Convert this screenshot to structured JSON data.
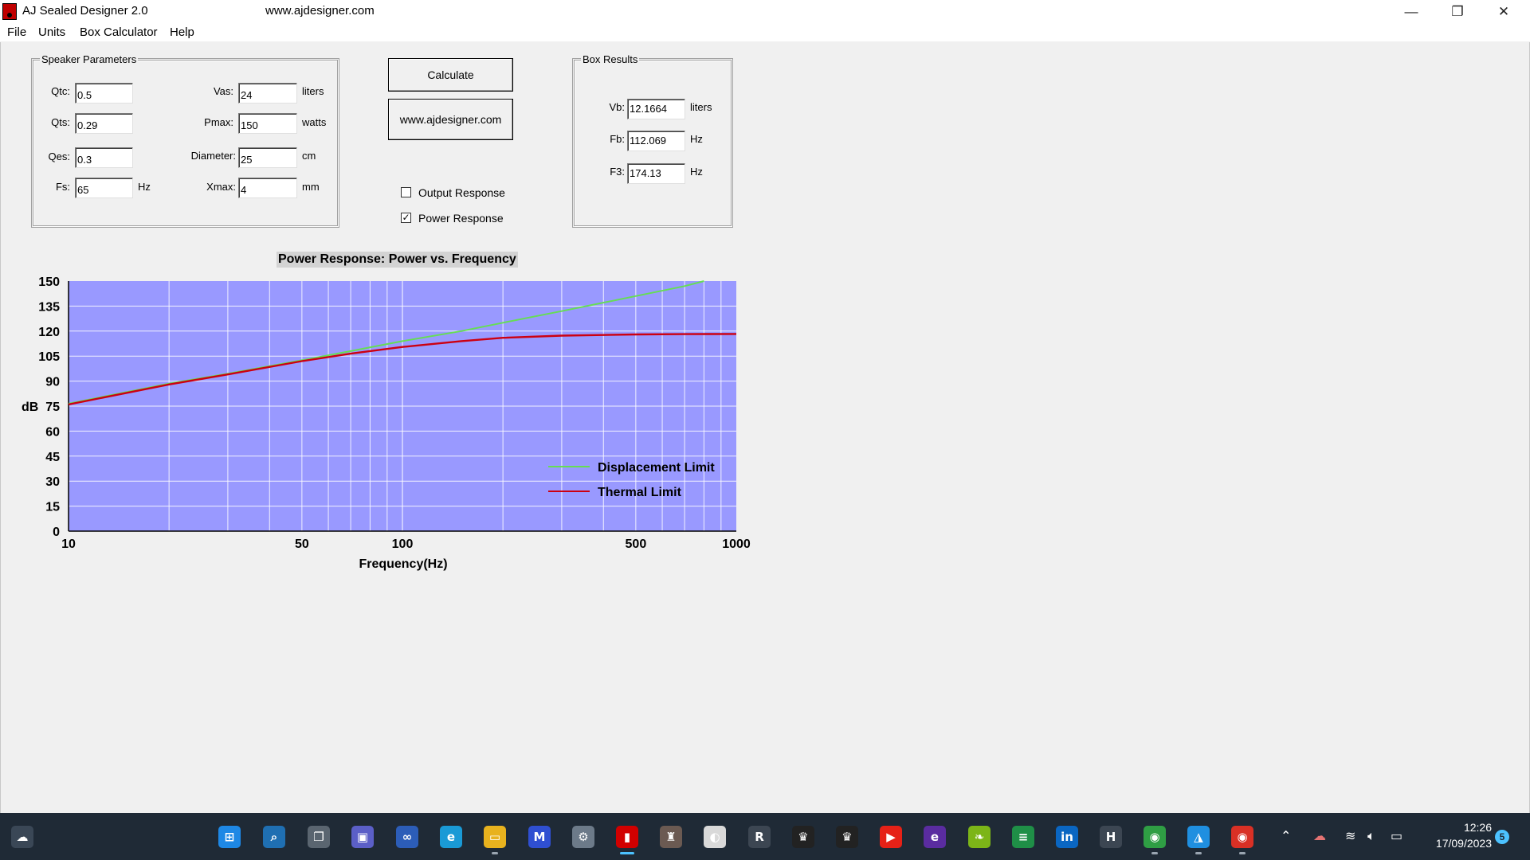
{
  "window": {
    "title": "AJ Sealed Designer 2.0",
    "url_caption": "www.ajdesigner.com",
    "minimize_glyph": "—",
    "maximize_glyph": "❐",
    "close_glyph": "✕"
  },
  "menu": [
    "File",
    "Units",
    "Box Calculator",
    "Help"
  ],
  "speaker_parameters": {
    "title": "Speaker Parameters",
    "fields": [
      {
        "label": "Qtc:",
        "value": "0.5",
        "unit": ""
      },
      {
        "label": "Qts:",
        "value": "0.29",
        "unit": ""
      },
      {
        "label": "Qes:",
        "value": "0.3",
        "unit": ""
      },
      {
        "label": "Fs:",
        "value": "65",
        "unit": "Hz"
      },
      {
        "label": "Vas:",
        "value": "24",
        "unit": "liters"
      },
      {
        "label": "Pmax:",
        "value": "150",
        "unit": "watts"
      },
      {
        "label": "Diameter:",
        "value": "25",
        "unit": "cm"
      },
      {
        "label": "Xmax:",
        "value": "4",
        "unit": "mm"
      }
    ]
  },
  "buttons": {
    "calculate": "Calculate",
    "website": "www.ajdesigner.com"
  },
  "options": {
    "output_response": {
      "label": "Output Response",
      "checked": false
    },
    "power_response": {
      "label": "Power Response",
      "checked": true
    },
    "check_glyph": "✓"
  },
  "box_results": {
    "title": "Box Results",
    "fields": [
      {
        "label": "Vb:",
        "value": "12.1664",
        "unit": "liters"
      },
      {
        "label": "Fb:",
        "value": "112.069",
        "unit": "Hz"
      },
      {
        "label": "F3:",
        "value": "174.13",
        "unit": "Hz"
      }
    ]
  },
  "chart_data": {
    "type": "line",
    "title": "Power Response: Power vs. Frequency",
    "xlabel": "Frequency(Hz)",
    "ylabel": "dB",
    "x_scale": "log",
    "xlim": [
      10,
      1000
    ],
    "ylim": [
      0,
      150
    ],
    "x_ticks": [
      10,
      50,
      100,
      500,
      1000
    ],
    "y_ticks": [
      0,
      15,
      30,
      45,
      60,
      75,
      90,
      105,
      120,
      135,
      150
    ],
    "grid": true,
    "legend_position": "bottom-right",
    "background_color": "#9999ff",
    "series": [
      {
        "name": "Displacement Limit",
        "color": "#66dd55",
        "x": [
          10,
          20,
          30,
          50,
          70,
          100,
          150,
          200,
          300,
          500,
          700,
          800
        ],
        "y": [
          76.5,
          88.5,
          94.5,
          102.5,
          108,
          114,
          120,
          125,
          132,
          141,
          147,
          150
        ]
      },
      {
        "name": "Thermal Limit",
        "color": "#cc0011",
        "x": [
          10,
          20,
          30,
          50,
          70,
          100,
          150,
          200,
          300,
          500,
          700,
          1000
        ],
        "y": [
          76,
          88,
          94,
          102,
          106.5,
          110.5,
          114,
          116,
          117.3,
          118,
          118.2,
          118.3
        ]
      }
    ]
  },
  "taskbar": {
    "time": "12:26",
    "date": "17/09/2023",
    "notifications": "5",
    "icons": [
      {
        "name": "weather-icon",
        "glyph": "☁",
        "color": "#3a4756"
      },
      {
        "name": "windows-start-icon",
        "glyph": "⊞",
        "color": "#1e88e5"
      },
      {
        "name": "search-icon",
        "glyph": "⌕",
        "color": "#1f6fb2"
      },
      {
        "name": "task-view-icon",
        "glyph": "❐",
        "color": "#5a6570"
      },
      {
        "name": "teams-chat-icon",
        "glyph": "▣",
        "color": "#5b5fc7"
      },
      {
        "name": "link-icon",
        "glyph": "∞",
        "color": "#2c5db8"
      },
      {
        "name": "edge-browser-icon",
        "glyph": "e",
        "color": "#1a9ad6"
      },
      {
        "name": "file-explorer-icon",
        "glyph": "▭",
        "color": "#e8b21e"
      },
      {
        "name": "app-m-icon",
        "glyph": "M",
        "color": "#2f4fd1"
      },
      {
        "name": "settings-icon",
        "glyph": "⚙",
        "color": "#6c7a89"
      },
      {
        "name": "aj-sealed-designer-icon",
        "glyph": "▮",
        "color": "#d10000"
      },
      {
        "name": "crest-icon",
        "glyph": "♜",
        "color": "#6b5a52"
      },
      {
        "name": "globe-app-icon",
        "glyph": "◐",
        "color": "#d9d9d9"
      },
      {
        "name": "r-app-icon",
        "glyph": "R",
        "color": "#3c4652"
      },
      {
        "name": "crown-app-icon",
        "glyph": "♛",
        "color": "#222222"
      },
      {
        "name": "crown-app-2-icon",
        "glyph": "♛",
        "color": "#222222"
      },
      {
        "name": "youtube-icon",
        "glyph": "▶",
        "color": "#e62117"
      },
      {
        "name": "e-app-icon",
        "glyph": "e",
        "color": "#5a2ca0"
      },
      {
        "name": "leaf-app-icon",
        "glyph": "❧",
        "color": "#7cb518"
      },
      {
        "name": "chart-app-icon",
        "glyph": "≡",
        "color": "#1f8f47"
      },
      {
        "name": "linkedin-icon",
        "glyph": "in",
        "color": "#0a66c2"
      },
      {
        "name": "h-app-icon",
        "glyph": "H",
        "color": "#3c4652"
      },
      {
        "name": "chrome-profile-icon",
        "glyph": "◉",
        "color": "#2f9e44"
      },
      {
        "name": "photos-icon",
        "glyph": "◮",
        "color": "#1f8fe0"
      },
      {
        "name": "chrome-icon",
        "glyph": "◉",
        "color": "#d93025"
      }
    ]
  }
}
